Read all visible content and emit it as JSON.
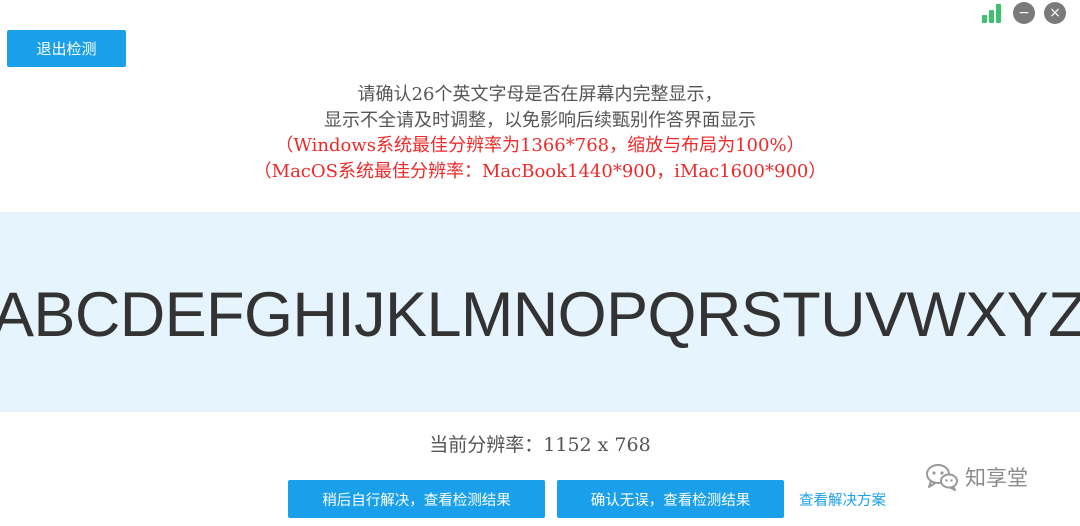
{
  "header": {
    "exit_label": "退出检测"
  },
  "window_controls": {
    "signal_icon": "signal-bars-icon",
    "minimize_glyph": "−",
    "close_glyph": "×",
    "signal_color": "#3cc16e"
  },
  "instructions": {
    "line1": "请确认26个英文字母是否在屏幕内完整显示，",
    "line2": "显示不全请及时调整，以免影响后续甄别作答界面显示",
    "windows_note": "（Windows系统最佳分辨率为1366*768，缩放与布局为100%）",
    "macos_note": "（MacOS系统最佳分辨率：MacBook1440*900，iMac1600*900）"
  },
  "alphabet": "ABCDEFGHIJKLMNOPQRSTUVWXYZ",
  "resolution": {
    "text": "当前分辨率：1152 x 768"
  },
  "actions": {
    "later_label": "稍后自行解决，查看检测结果",
    "confirm_label": "确认无误，查看检测结果",
    "solution_label": "查看解决方案"
  },
  "watermark": {
    "text": "知享堂",
    "icon": "wechat-icon"
  },
  "colors": {
    "accent": "#1aa0ea",
    "warning": "#ee2a2a",
    "band": "#e5f4fd"
  }
}
